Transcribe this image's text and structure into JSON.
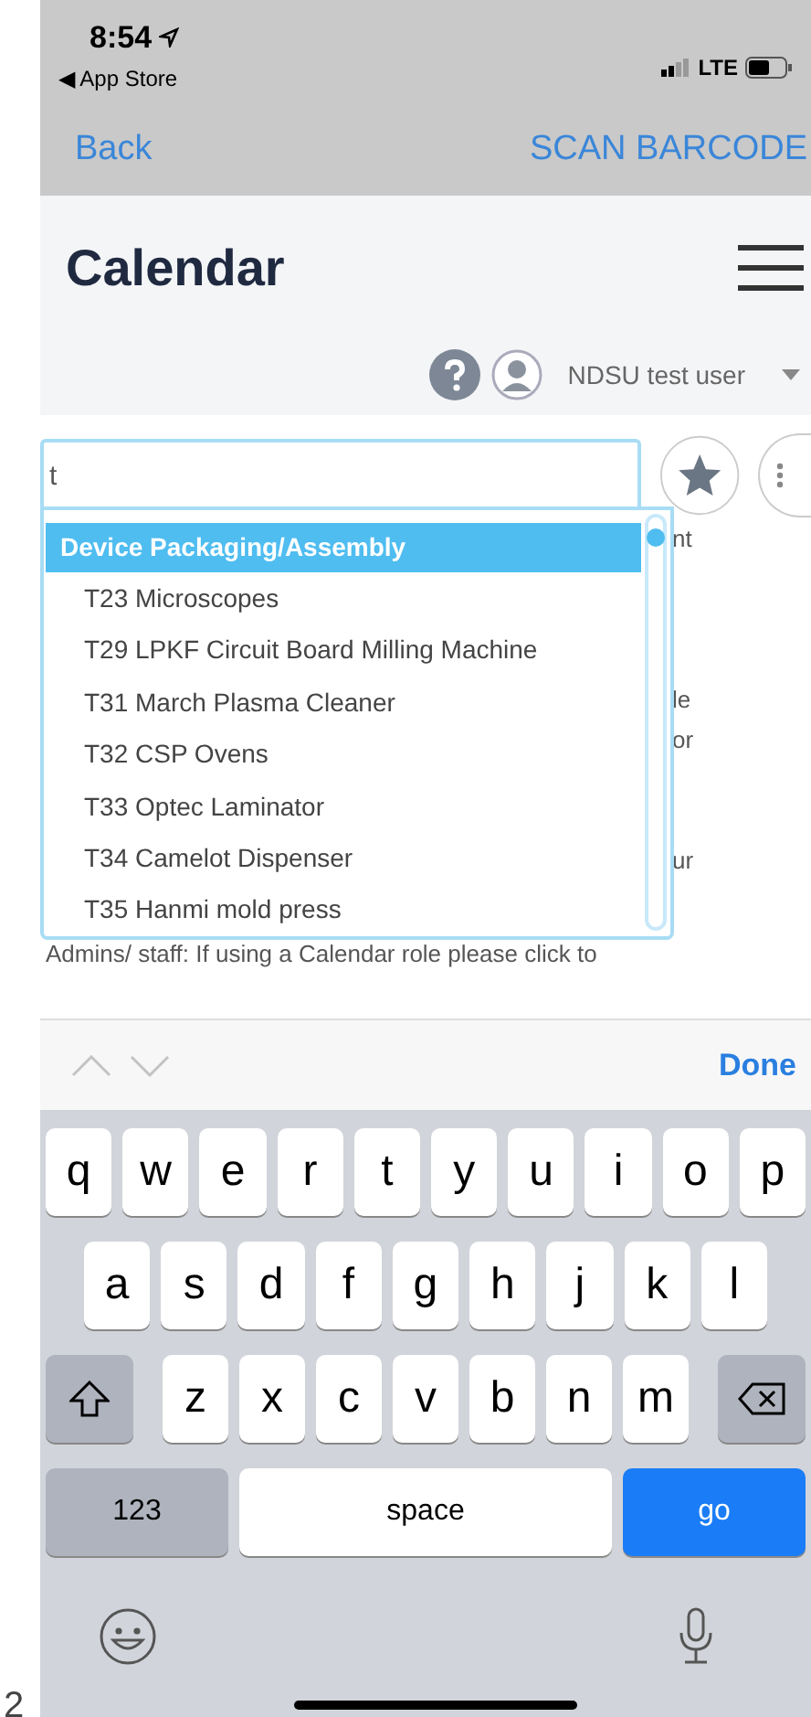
{
  "status_bar": {
    "time": "8:54",
    "back_app": "◀ App Store",
    "network": "LTE"
  },
  "nav_bar": {
    "back": "Back",
    "action": "SCAN BARCODE"
  },
  "header": {
    "title": "Calendar",
    "user": "NDSU test user"
  },
  "search": {
    "value": "t"
  },
  "dropdown": {
    "group": "Device Packaging/Assembly",
    "items": [
      {
        "label": "T23 Microscopes"
      },
      {
        "label": "T29 LPKF Circuit Board Milling Machine"
      },
      {
        "label": "T31 March Plasma Cleaner"
      },
      {
        "label": "T32 CSP Ovens"
      },
      {
        "label": "T33 Optec Laminator"
      },
      {
        "label": "T34 Camelot Dispenser"
      },
      {
        "label": "T35 Hanmi mold press"
      }
    ]
  },
  "background_fragments": [
    "nt",
    "le",
    "or",
    "ur"
  ],
  "notice": "Admins/ staff: If using a Calendar role please click to",
  "accessory_bar": {
    "done": "Done"
  },
  "keyboard": {
    "rows": [
      [
        {
          "kind": "letter",
          "label": "q"
        },
        {
          "kind": "letter",
          "label": "w"
        },
        {
          "kind": "letter",
          "label": "e"
        },
        {
          "kind": "letter",
          "label": "r"
        },
        {
          "kind": "letter",
          "label": "t"
        },
        {
          "kind": "letter",
          "label": "y"
        },
        {
          "kind": "letter",
          "label": "u"
        },
        {
          "kind": "letter",
          "label": "i"
        },
        {
          "kind": "letter",
          "label": "o"
        },
        {
          "kind": "letter",
          "label": "p"
        }
      ],
      [
        {
          "kind": "letter",
          "label": "a"
        },
        {
          "kind": "letter",
          "label": "s"
        },
        {
          "kind": "letter",
          "label": "d"
        },
        {
          "kind": "letter",
          "label": "f"
        },
        {
          "kind": "letter",
          "label": "g"
        },
        {
          "kind": "letter",
          "label": "h"
        },
        {
          "kind": "letter",
          "label": "j"
        },
        {
          "kind": "letter",
          "label": "k"
        },
        {
          "kind": "letter",
          "label": "l"
        }
      ],
      [
        {
          "kind": "shift"
        },
        {
          "kind": "letter",
          "label": "z"
        },
        {
          "kind": "letter",
          "label": "x"
        },
        {
          "kind": "letter",
          "label": "c"
        },
        {
          "kind": "letter",
          "label": "v"
        },
        {
          "kind": "letter",
          "label": "b"
        },
        {
          "kind": "letter",
          "label": "n"
        },
        {
          "kind": "letter",
          "label": "m"
        },
        {
          "kind": "delete"
        }
      ]
    ],
    "bottom_row": {
      "numbers": "123",
      "space": "space",
      "go": "go"
    }
  },
  "page_number": "2"
}
